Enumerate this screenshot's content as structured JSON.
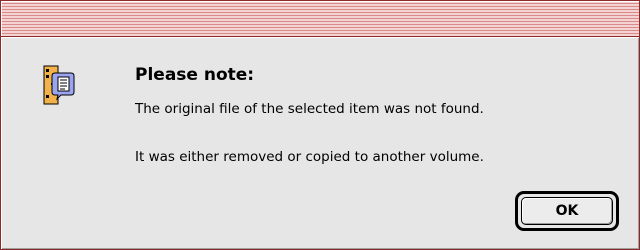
{
  "dialog": {
    "icon": "alias-note-icon",
    "heading": "Please note:",
    "message_line_1": "The original file of the selected item was not found.",
    "message_line_2": "It was either removed or copied to another volume.",
    "ok_label": "OK"
  },
  "colors": {
    "title_stripe_light": "#f4d3d3",
    "title_stripe_dark": "#d98a8a",
    "dialog_background": "#e6e6e6",
    "border": "#8a2a2a"
  }
}
